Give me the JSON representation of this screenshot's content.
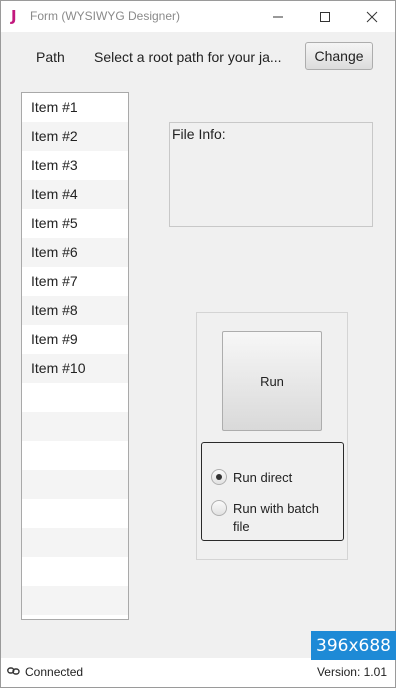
{
  "window": {
    "app_icon": "J",
    "title": "Form (WYSIWYG Designer)",
    "controls": {
      "minimize": "minimize-icon",
      "maximize": "maximize-icon",
      "close": "close-icon"
    }
  },
  "path_bar": {
    "label": "Path",
    "value": "Select a root path for your ja...",
    "change_button": "Change"
  },
  "items": [
    {
      "label": "Item #1"
    },
    {
      "label": "Item #2"
    },
    {
      "label": "Item #3"
    },
    {
      "label": "Item #4"
    },
    {
      "label": "Item #5"
    },
    {
      "label": "Item #6"
    },
    {
      "label": "Item #7"
    },
    {
      "label": "Item #8"
    },
    {
      "label": "Item #9"
    },
    {
      "label": "Item #10"
    }
  ],
  "file_info": {
    "label": "File Info:"
  },
  "run_panel": {
    "run_button": "Run",
    "options": [
      {
        "label": "Run direct",
        "selected": true
      },
      {
        "label": "Run with batch file",
        "selected": false
      }
    ]
  },
  "overlay": {
    "size_badge": "396x688",
    "badge_color": "#1e8ad6"
  },
  "status": {
    "icon": "link-icon",
    "text": "Connected",
    "version": "Version: 1.01"
  },
  "colors": {
    "app_icon": "#c2187d"
  }
}
